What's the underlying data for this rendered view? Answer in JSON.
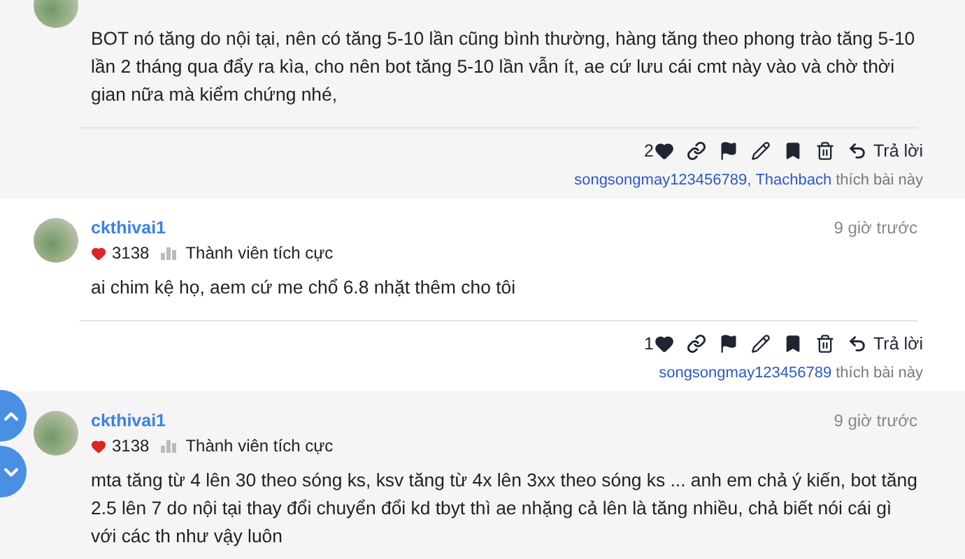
{
  "posts": [
    {
      "body": "BOT nó tăng do nội tại, nên có tăng 5-10 lần cũng bình thường, hàng tăng theo phong trào tăng 5-10 lần 2 tháng qua đẩy ra kìa, cho nên bot tăng 5-10 lần vẫn ít, ae cứ lưu cái cmt này vào và chờ thời gian nữa mà kiểm chứng nhé,",
      "like_count": "2",
      "reply_label": "Trả lời",
      "liked_by": [
        "songsongmay123456789",
        "Thachbach"
      ],
      "separator": ",",
      "liked_suffix": "thích bài này"
    },
    {
      "author": "ckthivai1",
      "score": "3138",
      "rank": "Thành viên tích cực",
      "time": "9 giờ trước",
      "body": "ai chim kệ họ, aem cứ me chổ 6.8 nhặt thêm cho tôi",
      "like_count": "1",
      "reply_label": "Trả lời",
      "liked_by": [
        "songsongmay123456789"
      ],
      "liked_suffix": "thích bài này"
    },
    {
      "author": "ckthivai1",
      "score": "3138",
      "rank": "Thành viên tích cực",
      "time": "9 giờ trước",
      "body": "mta tăng từ 4 lên 30 theo sóng ks, ksv tăng từ 4x lên 3xx theo sóng ks ... anh em chả ý kiến, bot tăng 2.5 lên 7 do nội tại thay đổi chuyển đổi kd tbyt thì ae nhặng cả lên là tăng nhiều, chả biết nói cái gì với các th như vậy luôn"
    }
  ]
}
